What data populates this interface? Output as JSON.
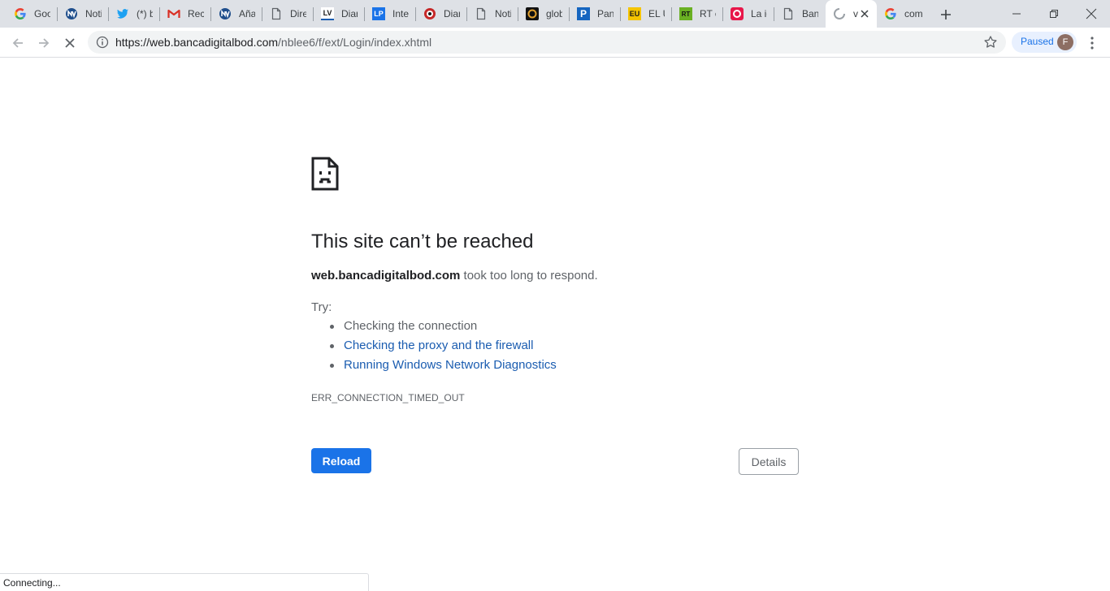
{
  "tabs": [
    {
      "title": "Goo",
      "icon": "google-g-icon",
      "active": false
    },
    {
      "title": "Noti",
      "icon": "news-globe-icon",
      "active": false
    },
    {
      "title": "(*) b",
      "icon": "twitter-bird-icon",
      "active": false
    },
    {
      "title": "Reci",
      "icon": "gmail-m-icon",
      "active": false
    },
    {
      "title": "Aña",
      "icon": "news-globe-icon",
      "active": false
    },
    {
      "title": "Dire",
      "icon": "page-icon",
      "active": false
    },
    {
      "title": "Diar",
      "icon": "lv-logo-icon",
      "active": false
    },
    {
      "title": "Inter",
      "icon": "lp-logo-icon",
      "active": false
    },
    {
      "title": "Diar",
      "icon": "diario-logo-icon",
      "active": false
    },
    {
      "title": "Noti",
      "icon": "page-icon",
      "active": false
    },
    {
      "title": "glob",
      "icon": "globovision-icon",
      "active": false
    },
    {
      "title": "Panc",
      "icon": "panorama-p-icon",
      "active": false
    },
    {
      "title": "EL U",
      "icon": "eu-logo-icon",
      "active": false
    },
    {
      "title": "RT e",
      "icon": "rt-logo-icon",
      "active": false
    },
    {
      "title": "La ig",
      "icon": "red-circle-icon",
      "active": false
    },
    {
      "title": "Banc",
      "icon": "page-icon",
      "active": false
    },
    {
      "title": "v",
      "icon": "loading-spinner-icon",
      "active": true
    },
    {
      "title": "com",
      "icon": "google-g-icon",
      "active": false
    }
  ],
  "browser": {
    "url_host": "https://web.bancadigitalbod.com",
    "url_path": "/nblee6/f/ext/Login/index.xhtml",
    "profile_label": "Paused",
    "avatar_initial": "F"
  },
  "error": {
    "title": "This site can’t be reached",
    "host": "web.bancadigitalbod.com",
    "message": " took too long to respond.",
    "try_label": "Try:",
    "suggestions": [
      {
        "text": "Checking the connection",
        "link": false
      },
      {
        "text": "Checking the proxy and the firewall",
        "link": true
      },
      {
        "text": "Running Windows Network Diagnostics",
        "link": true
      }
    ],
    "code": "ERR_CONNECTION_TIMED_OUT",
    "reload_label": "Reload",
    "details_label": "Details"
  },
  "status": {
    "text": "Connecting..."
  },
  "colors": {
    "accent": "#1a73e8",
    "link": "#1a5cb0",
    "tabstrip": "#dee1e6",
    "text": "#5f6368"
  }
}
